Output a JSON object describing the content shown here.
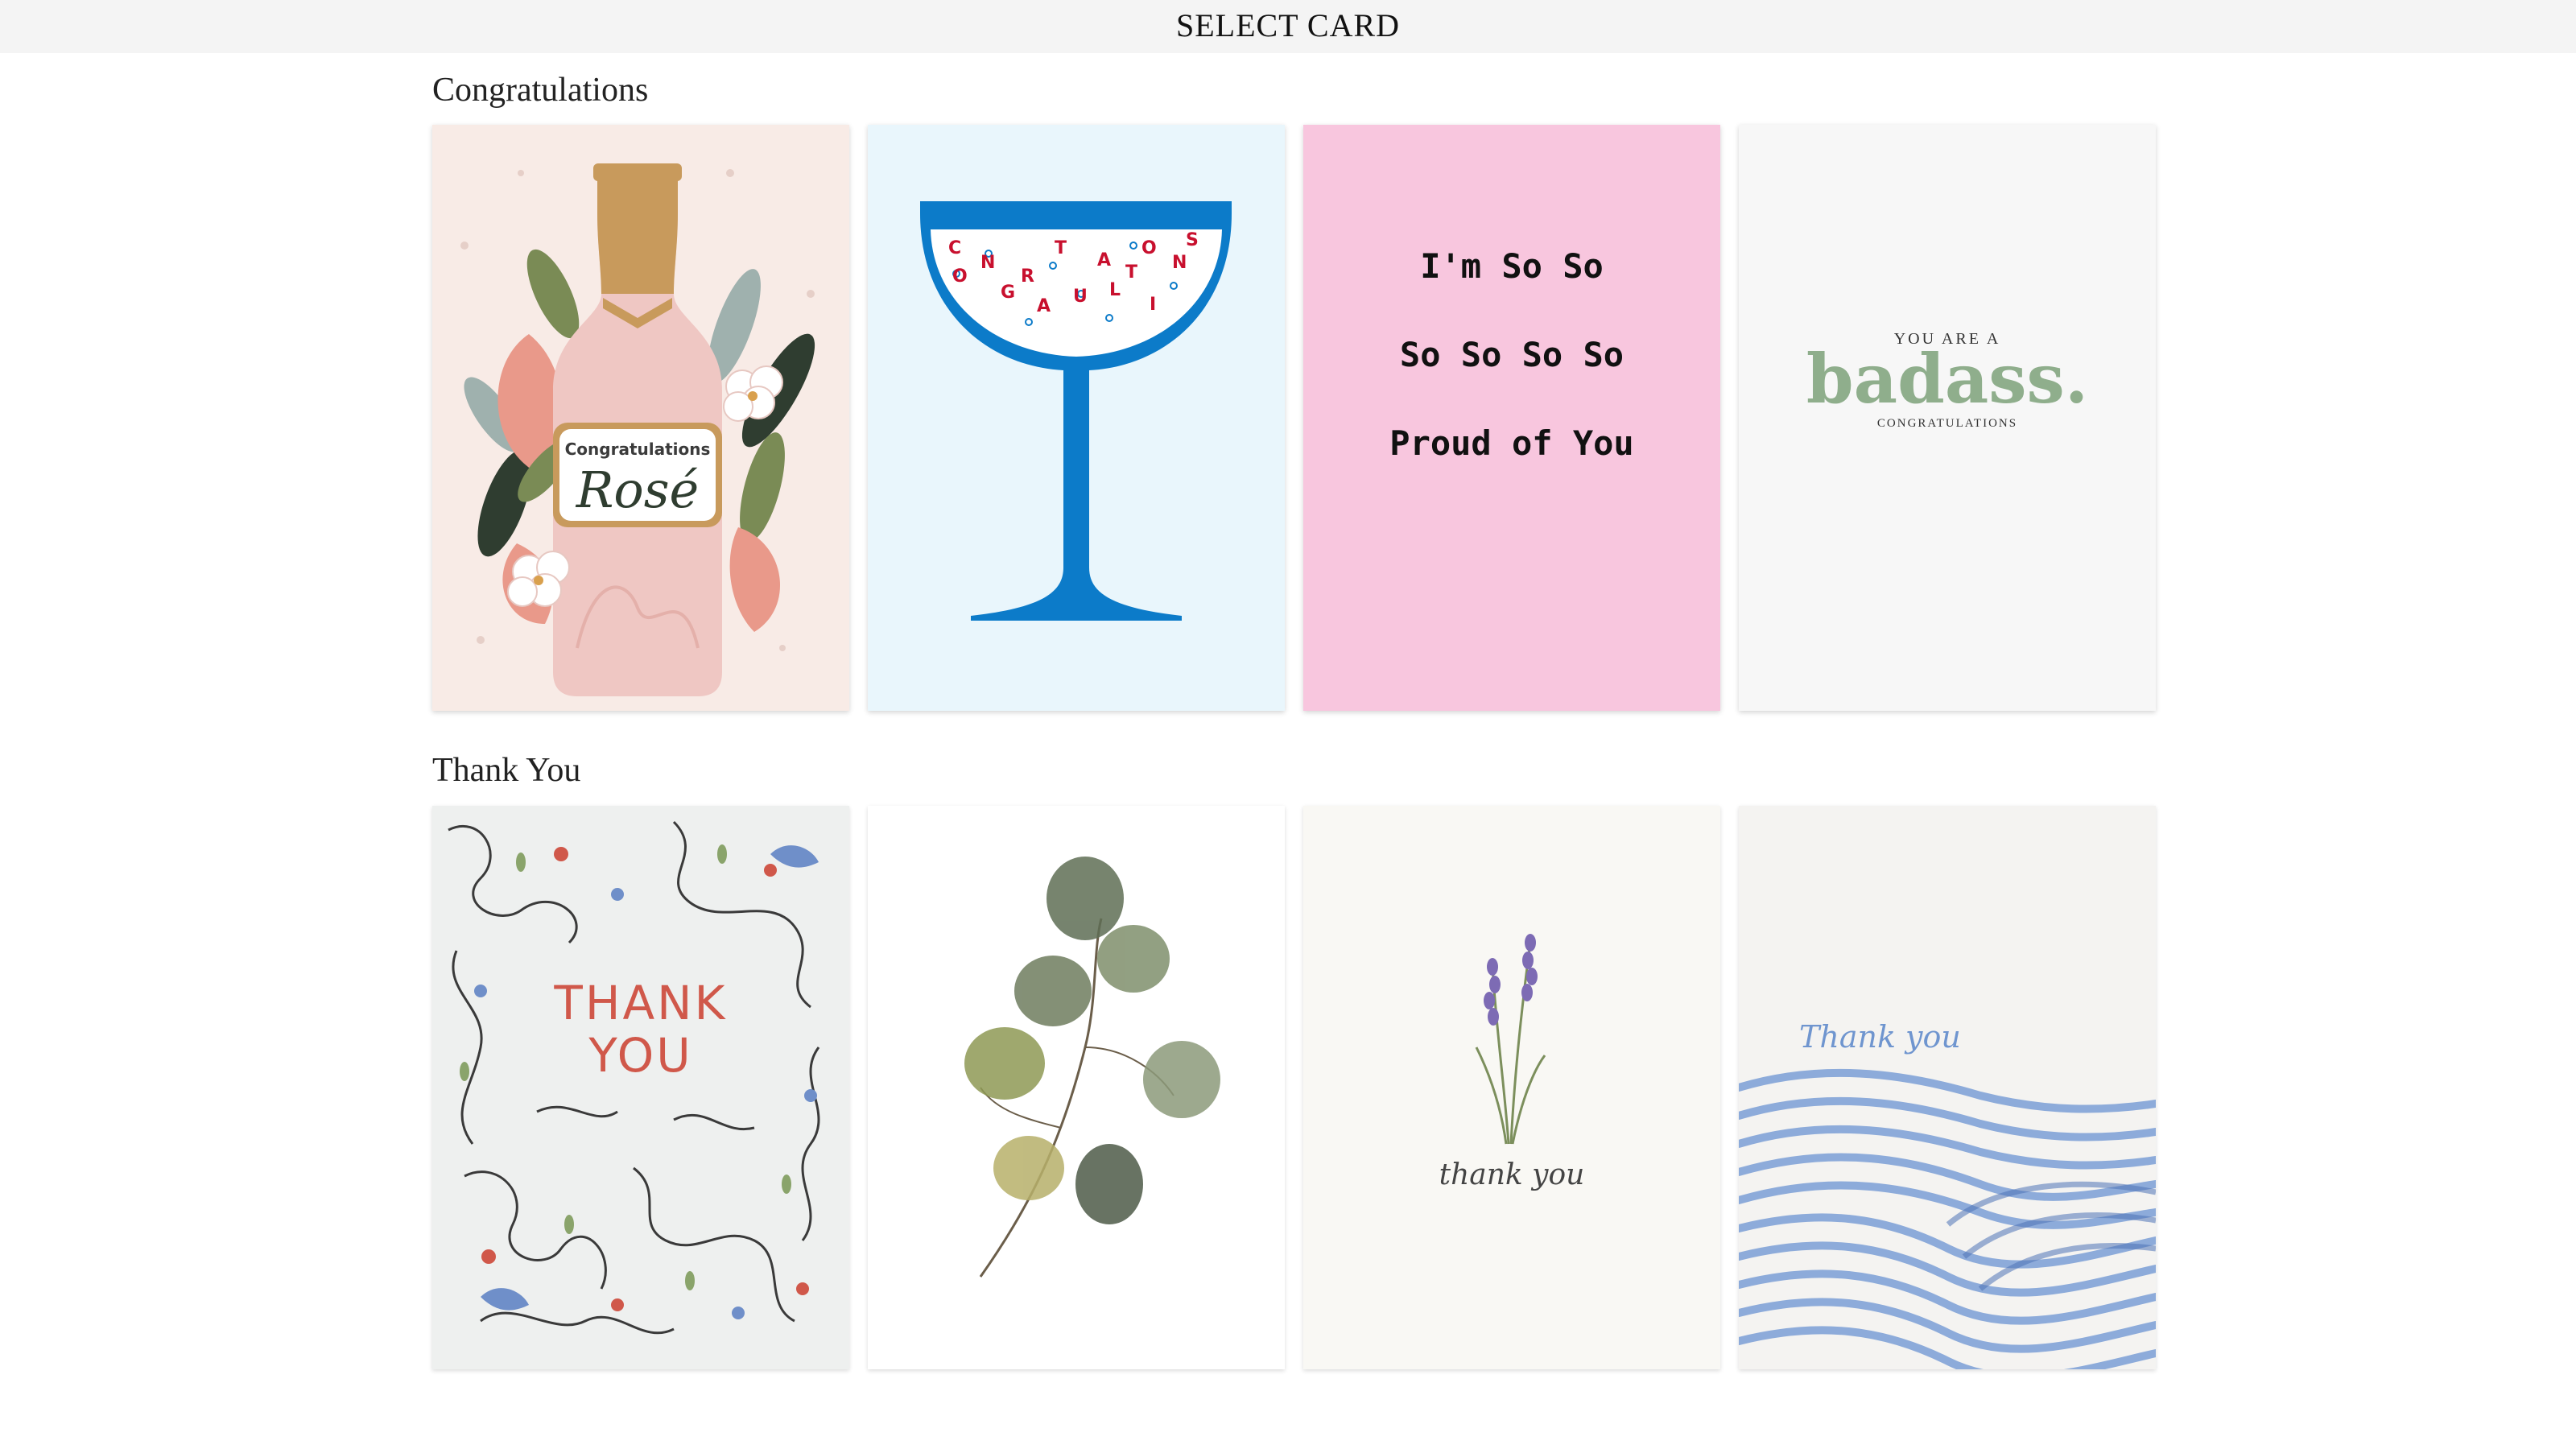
{
  "header": {
    "title": "SELECT CARD"
  },
  "sections": [
    {
      "title": "Congratulations",
      "cards": [
        {
          "id": "rose",
          "label_top": "Congratulations",
          "label_main": "Rosé",
          "bg": "#f8ebe6"
        },
        {
          "id": "coupe",
          "text": "CONGRATULATIONS",
          "bg": "#e9f6fc",
          "accent": "#0c7bc9"
        },
        {
          "id": "proud",
          "lines": [
            "I'm So So",
            "So So So So",
            "Proud of You"
          ],
          "bg": "#f8c6de"
        },
        {
          "id": "badass",
          "line1": "YOU ARE A",
          "line2": "badass.",
          "line3": "CONGRATULATIONS",
          "bg": "#f7f7f7",
          "accent": "#8fae8c"
        }
      ]
    },
    {
      "title": "Thank You",
      "cards": [
        {
          "id": "doodle",
          "line1": "THANK",
          "line2": "YOU",
          "bg": "#eef0ef",
          "accent": "#d0584a"
        },
        {
          "id": "eucalyptus",
          "bg": "#ffffff"
        },
        {
          "id": "lavender",
          "text": "thank you",
          "bg": "#f9f8f4"
        },
        {
          "id": "waves",
          "text": "Thank you",
          "bg": "#f4f3f1",
          "accent": "#6f95cf"
        }
      ]
    }
  ]
}
